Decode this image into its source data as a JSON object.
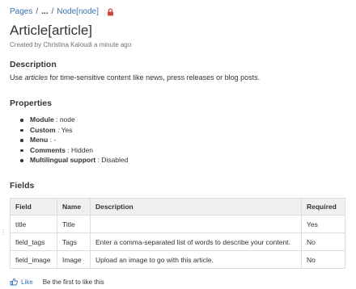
{
  "breadcrumb": {
    "root": "Pages",
    "separator": "/",
    "ellipsis": "...",
    "current": "Node[node]"
  },
  "icons": {
    "restriction": "lock-icon",
    "like": "thumbs-up-icon"
  },
  "colors": {
    "link": "#3572b0",
    "lock": "#d04437",
    "table_header_bg": "#f0f0f0"
  },
  "page": {
    "title": "Article[article]",
    "byline": "Created by Christina Kaloudi a minute ago"
  },
  "description": {
    "heading": "Description",
    "text_before": "Use ",
    "text_emphasis": "articles",
    "text_after": " for time-sensitive content like news, press releases or blog posts."
  },
  "properties": {
    "heading": "Properties",
    "items": [
      {
        "key": "Module",
        "value": " : node"
      },
      {
        "key": "Custom",
        "value": " : Yes"
      },
      {
        "key": "Menu",
        "value": " : -"
      },
      {
        "key": "Comments",
        "value": " : Hidden"
      },
      {
        "key": "Multilingual support",
        "value": " : Disabled"
      }
    ]
  },
  "fields": {
    "heading": "Fields",
    "columns": [
      "Field",
      "Name",
      "Description",
      "Required"
    ],
    "rows": [
      {
        "field": "title",
        "name": "Title",
        "description": "",
        "required": "Yes"
      },
      {
        "field": "field_tags",
        "name": "Tags",
        "description": "Enter a comma-separated list of words to describe your content.",
        "required": "No"
      },
      {
        "field": "field_image",
        "name": "Image",
        "description": "Upload an image to go with this article.",
        "required": "No"
      }
    ]
  },
  "like_bar": {
    "like_label": "Like",
    "status_text": "Be the first to like this"
  }
}
